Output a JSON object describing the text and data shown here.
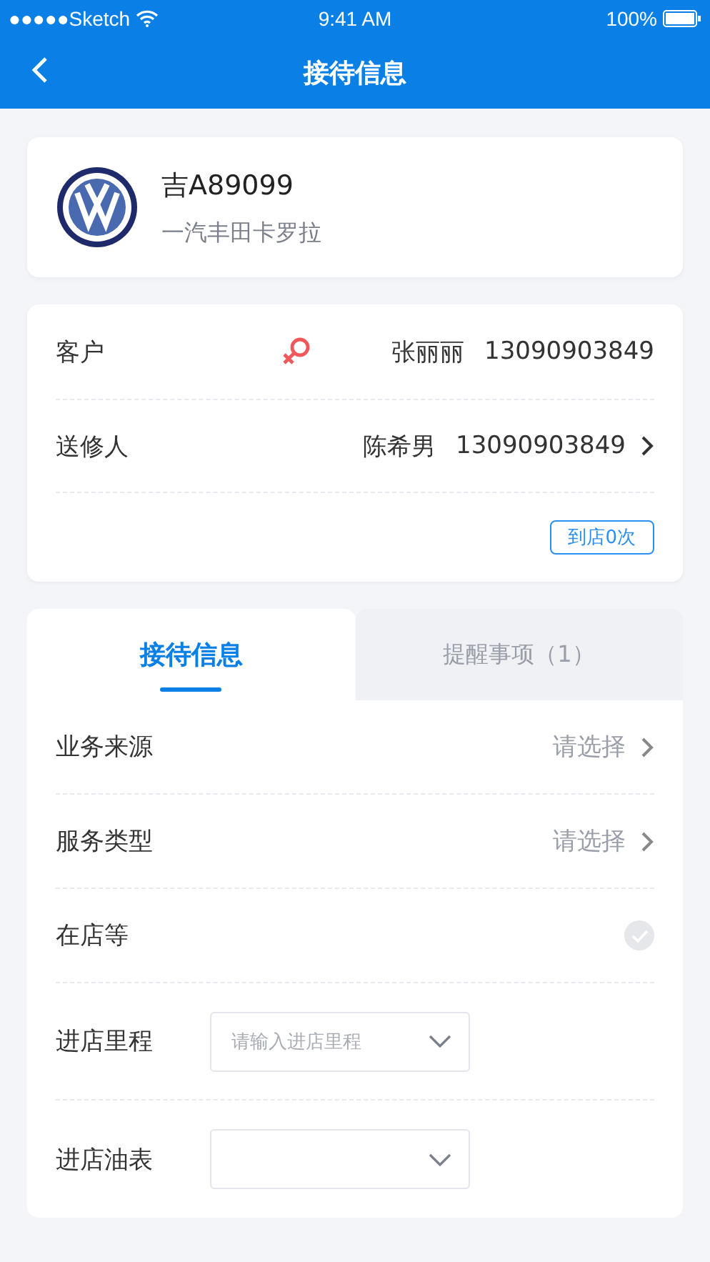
{
  "status_bar": {
    "carrier": "●●●●●Sketch",
    "time": "9:41 AM",
    "battery": "100%"
  },
  "nav": {
    "title": "接待信息"
  },
  "vehicle": {
    "plate": "吉A89099",
    "model": "一汽丰田卡罗拉"
  },
  "contacts": [
    {
      "label": "客户",
      "female": true,
      "name": "张丽丽",
      "phone": "13090903849",
      "link": false
    },
    {
      "label": "送修人",
      "female": false,
      "name": "陈希男",
      "phone": "13090903849",
      "link": true
    }
  ],
  "visits": "到店0次",
  "tabs": [
    {
      "label": "接待信息",
      "selected": true
    },
    {
      "label": "提醒事项（1）",
      "selected": false
    }
  ],
  "form": [
    {
      "kind": "select",
      "label": "业务来源",
      "value": "请选择"
    },
    {
      "kind": "select",
      "label": "服务类型",
      "value": "请选择"
    },
    {
      "kind": "check",
      "label": "在店等",
      "checked": false
    },
    {
      "kind": "dropdown",
      "label": "进店里程",
      "placeholder": "请输入进店里程"
    },
    {
      "kind": "dropdown",
      "label": "进店油表"
    }
  ]
}
